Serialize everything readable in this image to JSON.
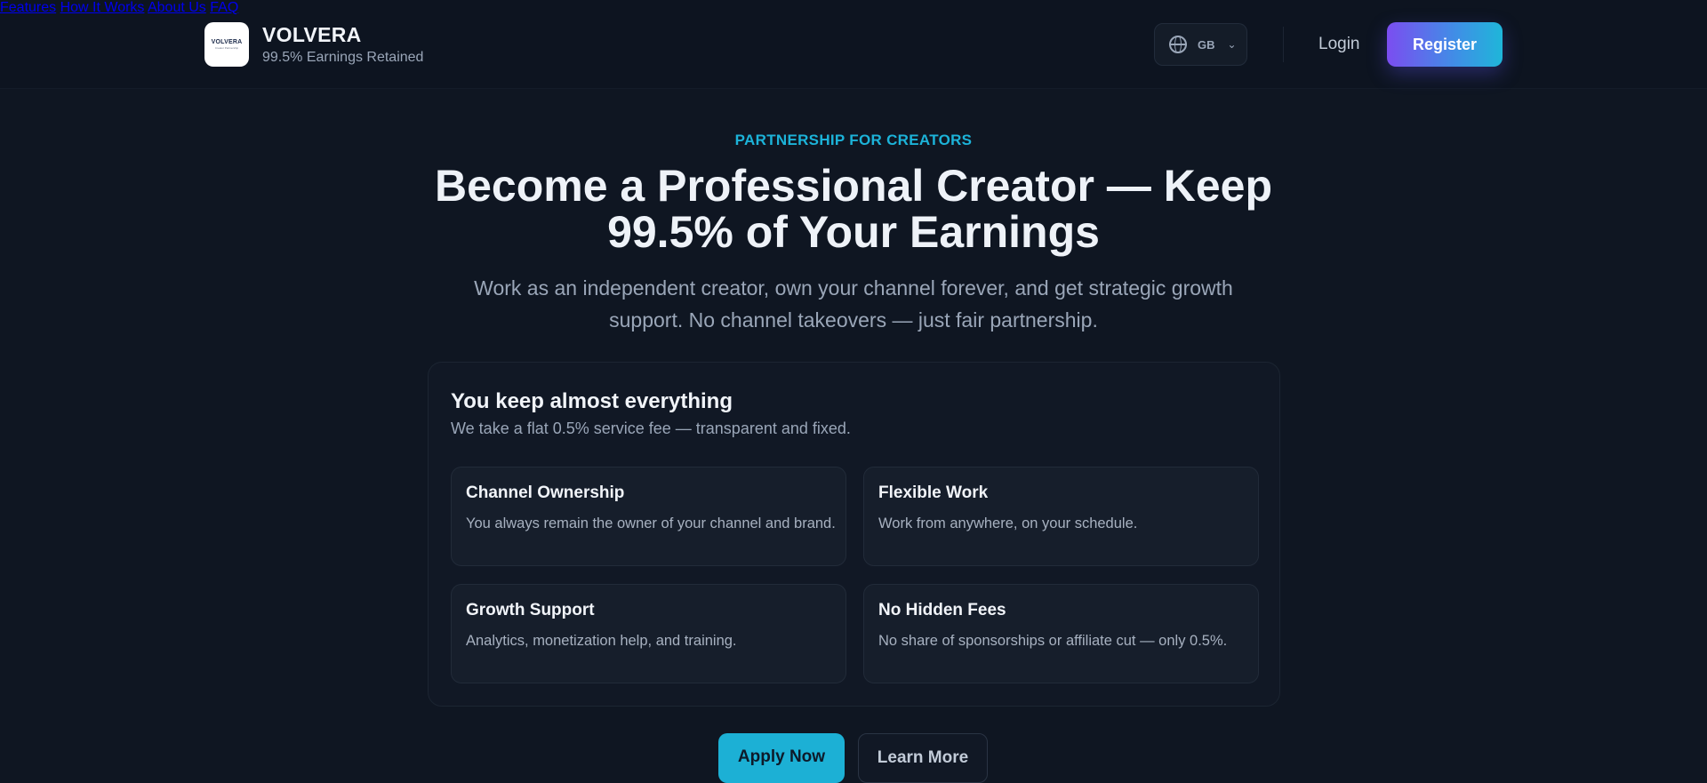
{
  "brand": {
    "logo_text": "VOLVERA",
    "logo_tagline": "Creator Partnership",
    "name": "VOLVERA",
    "subtitle": "99.5% Earnings Retained"
  },
  "nav": {
    "items": [
      {
        "label": "Features"
      },
      {
        "label": "How It Works"
      },
      {
        "label": "About Us"
      },
      {
        "label": "FAQ"
      }
    ],
    "language": {
      "code": "GB",
      "icon": "globe-icon"
    },
    "login_label": "Login",
    "register_label": "Register"
  },
  "hero": {
    "eyebrow": "PARTNERSHIP FOR CREATORS",
    "headline": "Become a Professional Creator — Keep 99.5% of Your Earnings",
    "lead": "Work as an independent creator, own your channel forever, and get strategic growth support. No channel takeovers — just fair partnership."
  },
  "panel": {
    "title": "You keep almost everything",
    "subtitle": "We take a flat 0.5% service fee — transparent and fixed.",
    "cards": [
      {
        "title": "Channel Ownership",
        "text": "You always remain the owner of your channel and brand."
      },
      {
        "title": "Flexible Work",
        "text": "Work from anywhere, on your schedule."
      },
      {
        "title": "Growth Support",
        "text": "Analytics, monetization help, and training."
      },
      {
        "title": "No Hidden Fees",
        "text": "No share of sponsorships or affiliate cut — only 0.5%."
      }
    ]
  },
  "cta": {
    "primary_label": "Apply Now",
    "secondary_label": "Learn More"
  },
  "colors": {
    "background": "#0f1622",
    "accent": "#1cb3d9",
    "register_gradient_start": "#7b4df0",
    "register_gradient_end": "#1fb6d9"
  }
}
